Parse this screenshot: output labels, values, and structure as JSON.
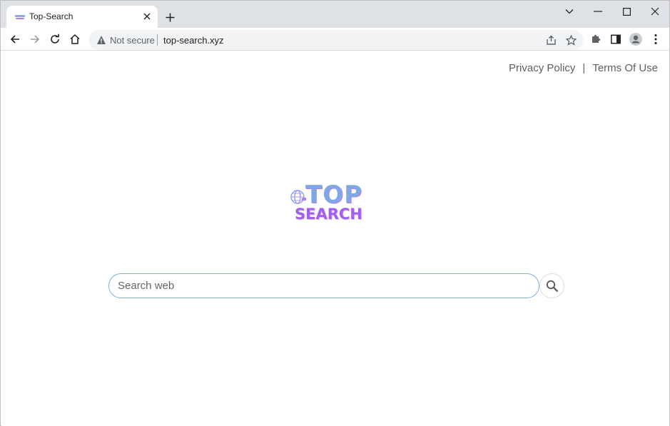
{
  "browser": {
    "tab": {
      "title": "Top-Search"
    },
    "address_bar": {
      "security_label": "Not secure",
      "url": "top-search.xyz"
    }
  },
  "page": {
    "links": {
      "privacy": "Privacy Policy",
      "separator": "|",
      "terms": "Terms Of Use"
    },
    "logo": {
      "line1": "TOP",
      "line2": "SEARCH"
    },
    "search": {
      "placeholder": "Search web",
      "value": ""
    }
  },
  "colors": {
    "logo_blue": "#7fa7e8",
    "logo_purple": "#a35ef0",
    "search_border": "#7fb1e0",
    "chrome_bg": "#dee1e6"
  },
  "icons": {
    "tab_favicon": "top-search-favicon",
    "tab_close": "close-icon",
    "new_tab": "plus-icon",
    "back": "arrow-left-icon",
    "forward": "arrow-right-icon",
    "reload": "reload-icon",
    "home": "home-icon",
    "security": "warning-icon",
    "share": "share-icon",
    "bookmark": "star-icon",
    "extensions": "puzzle-icon",
    "side_panel": "side-panel-icon",
    "profile": "profile-icon",
    "menu": "kebab-menu-icon",
    "search": "search-icon"
  }
}
